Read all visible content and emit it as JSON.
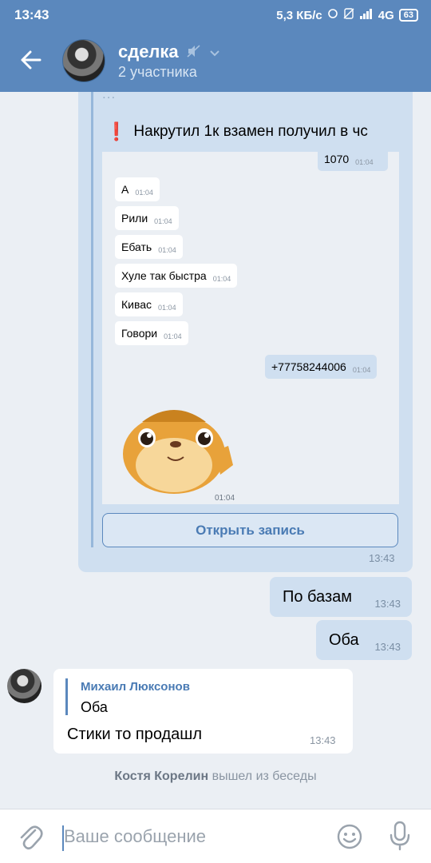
{
  "status_bar": {
    "time": "13:43",
    "speed": "5,3 КБ/с",
    "network": "4G",
    "battery": "63"
  },
  "header": {
    "title": "сделка",
    "subtitle": "2 участника"
  },
  "forwarded_post": {
    "cut_text": "...",
    "warning_text": "Накрутил 1к взамен получил в чс",
    "screenshot": {
      "messages": [
        {
          "text": "1070",
          "time": "01:04",
          "direction": "out"
        },
        {
          "text": "А",
          "time": "01:04",
          "direction": "in"
        },
        {
          "text": "Рили",
          "time": "01:04",
          "direction": "in"
        },
        {
          "text": "Ебать",
          "time": "01:04",
          "direction": "in"
        },
        {
          "text": "Хуле так быстра",
          "time": "01:04",
          "direction": "in"
        },
        {
          "text": "Кивас",
          "time": "01:04",
          "direction": "in"
        },
        {
          "text": "Говори",
          "time": "01:04",
          "direction": "in"
        },
        {
          "text": "+77758244006",
          "time": "01:04",
          "direction": "out"
        }
      ],
      "sticker_time": "01:04"
    },
    "open_button": "Открыть запись",
    "time": "13:43"
  },
  "outgoing": [
    {
      "text": "По базам",
      "time": "13:43"
    },
    {
      "text": "Оба",
      "time": "13:43"
    }
  ],
  "incoming": {
    "reply_author": "Михаил Люксонов",
    "reply_text": "Оба",
    "text": "Стики то продашл",
    "time": "13:43"
  },
  "system_message": {
    "name": "Костя Корелин",
    "action": "вышел из беседы"
  },
  "input": {
    "placeholder": "Ваше сообщение"
  },
  "colors": {
    "header": "#5b88bd",
    "bubble_out": "#cfdff0",
    "background": "#ebeff4",
    "accent": "#4a7bb4"
  }
}
